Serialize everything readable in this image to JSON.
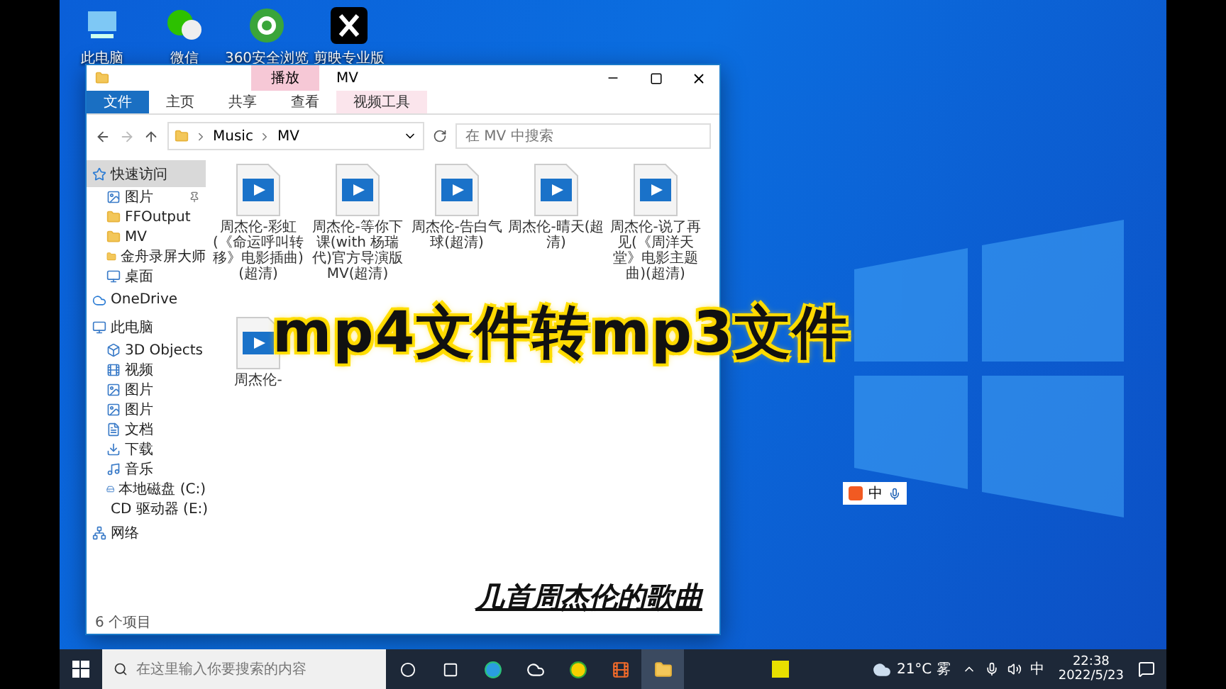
{
  "desktop_icons": [
    {
      "label": "此电脑",
      "kind": "pc"
    },
    {
      "label": "微信",
      "kind": "chat"
    },
    {
      "label": "360安全浏览",
      "kind": "browser"
    },
    {
      "label": "剪映专业版",
      "kind": "editor"
    }
  ],
  "window": {
    "title": "MV",
    "context_tab": "播放",
    "ribbon_tabs": [
      {
        "label": "文件",
        "kind": "file"
      },
      {
        "label": "主页",
        "kind": "tab"
      },
      {
        "label": "共享",
        "kind": "tab"
      },
      {
        "label": "查看",
        "kind": "tab"
      },
      {
        "label": "视频工具",
        "kind": "context"
      }
    ],
    "address": [
      "Music",
      "MV"
    ],
    "search": {
      "placeholder": "在 MV 中搜索"
    },
    "nav": [
      {
        "label": "快速访问",
        "kind": "star",
        "selected": true,
        "children": [
          {
            "label": "图片",
            "kind": "pictures",
            "selected": false,
            "pinned": true
          },
          {
            "label": "FFOutput",
            "kind": "folder",
            "selected": false
          },
          {
            "label": "MV",
            "kind": "folder",
            "selected": false
          },
          {
            "label": "金舟录屏大师",
            "kind": "folder",
            "selected": false
          },
          {
            "label": "桌面",
            "kind": "desktop",
            "selected": false
          }
        ]
      },
      {
        "label": "OneDrive",
        "kind": "cloud",
        "selected": false
      },
      {
        "label": "此电脑",
        "kind": "pc",
        "selected": false,
        "children": [
          {
            "label": "3D Objects",
            "kind": "cube",
            "selected": false
          },
          {
            "label": "视频",
            "kind": "video",
            "selected": false
          },
          {
            "label": "图片",
            "kind": "pictures",
            "selected": false
          },
          {
            "label": "图片",
            "kind": "pictures",
            "selected": false
          },
          {
            "label": "文档",
            "kind": "doc",
            "selected": false
          },
          {
            "label": "下载",
            "kind": "download",
            "selected": false
          },
          {
            "label": "音乐",
            "kind": "music",
            "selected": false
          },
          {
            "label": "本地磁盘 (C:)",
            "kind": "disk",
            "selected": false
          },
          {
            "label": "CD 驱动器 (E:)",
            "kind": "cd",
            "selected": false
          }
        ]
      },
      {
        "label": "网络",
        "kind": "network",
        "selected": false
      }
    ],
    "files": [
      {
        "name": "周杰伦-彩虹 (《命运呼叫转移》电影插曲)(超清)"
      },
      {
        "name": "周杰伦-等你下课(with 杨瑞代)官方导演版MV(超清)"
      },
      {
        "name": "周杰伦-告白气球(超清)"
      },
      {
        "name": "周杰伦-晴天(超清)"
      },
      {
        "name": "周杰伦-说了再见(《周洋天堂》电影主题曲)(超清)"
      },
      {
        "name": "周杰伦-"
      }
    ],
    "status": "6 个项目"
  },
  "overlay": {
    "title": "mp4文件转mp3文件",
    "subtitle": "几首周杰伦的歌曲"
  },
  "ime_bar": {
    "mode": "中"
  },
  "taskbar": {
    "search_placeholder": "在这里输入你要搜索的内容",
    "weather": "21°C 雾",
    "input_mode": "中",
    "time": "22:38",
    "date": "2022/5/23"
  }
}
